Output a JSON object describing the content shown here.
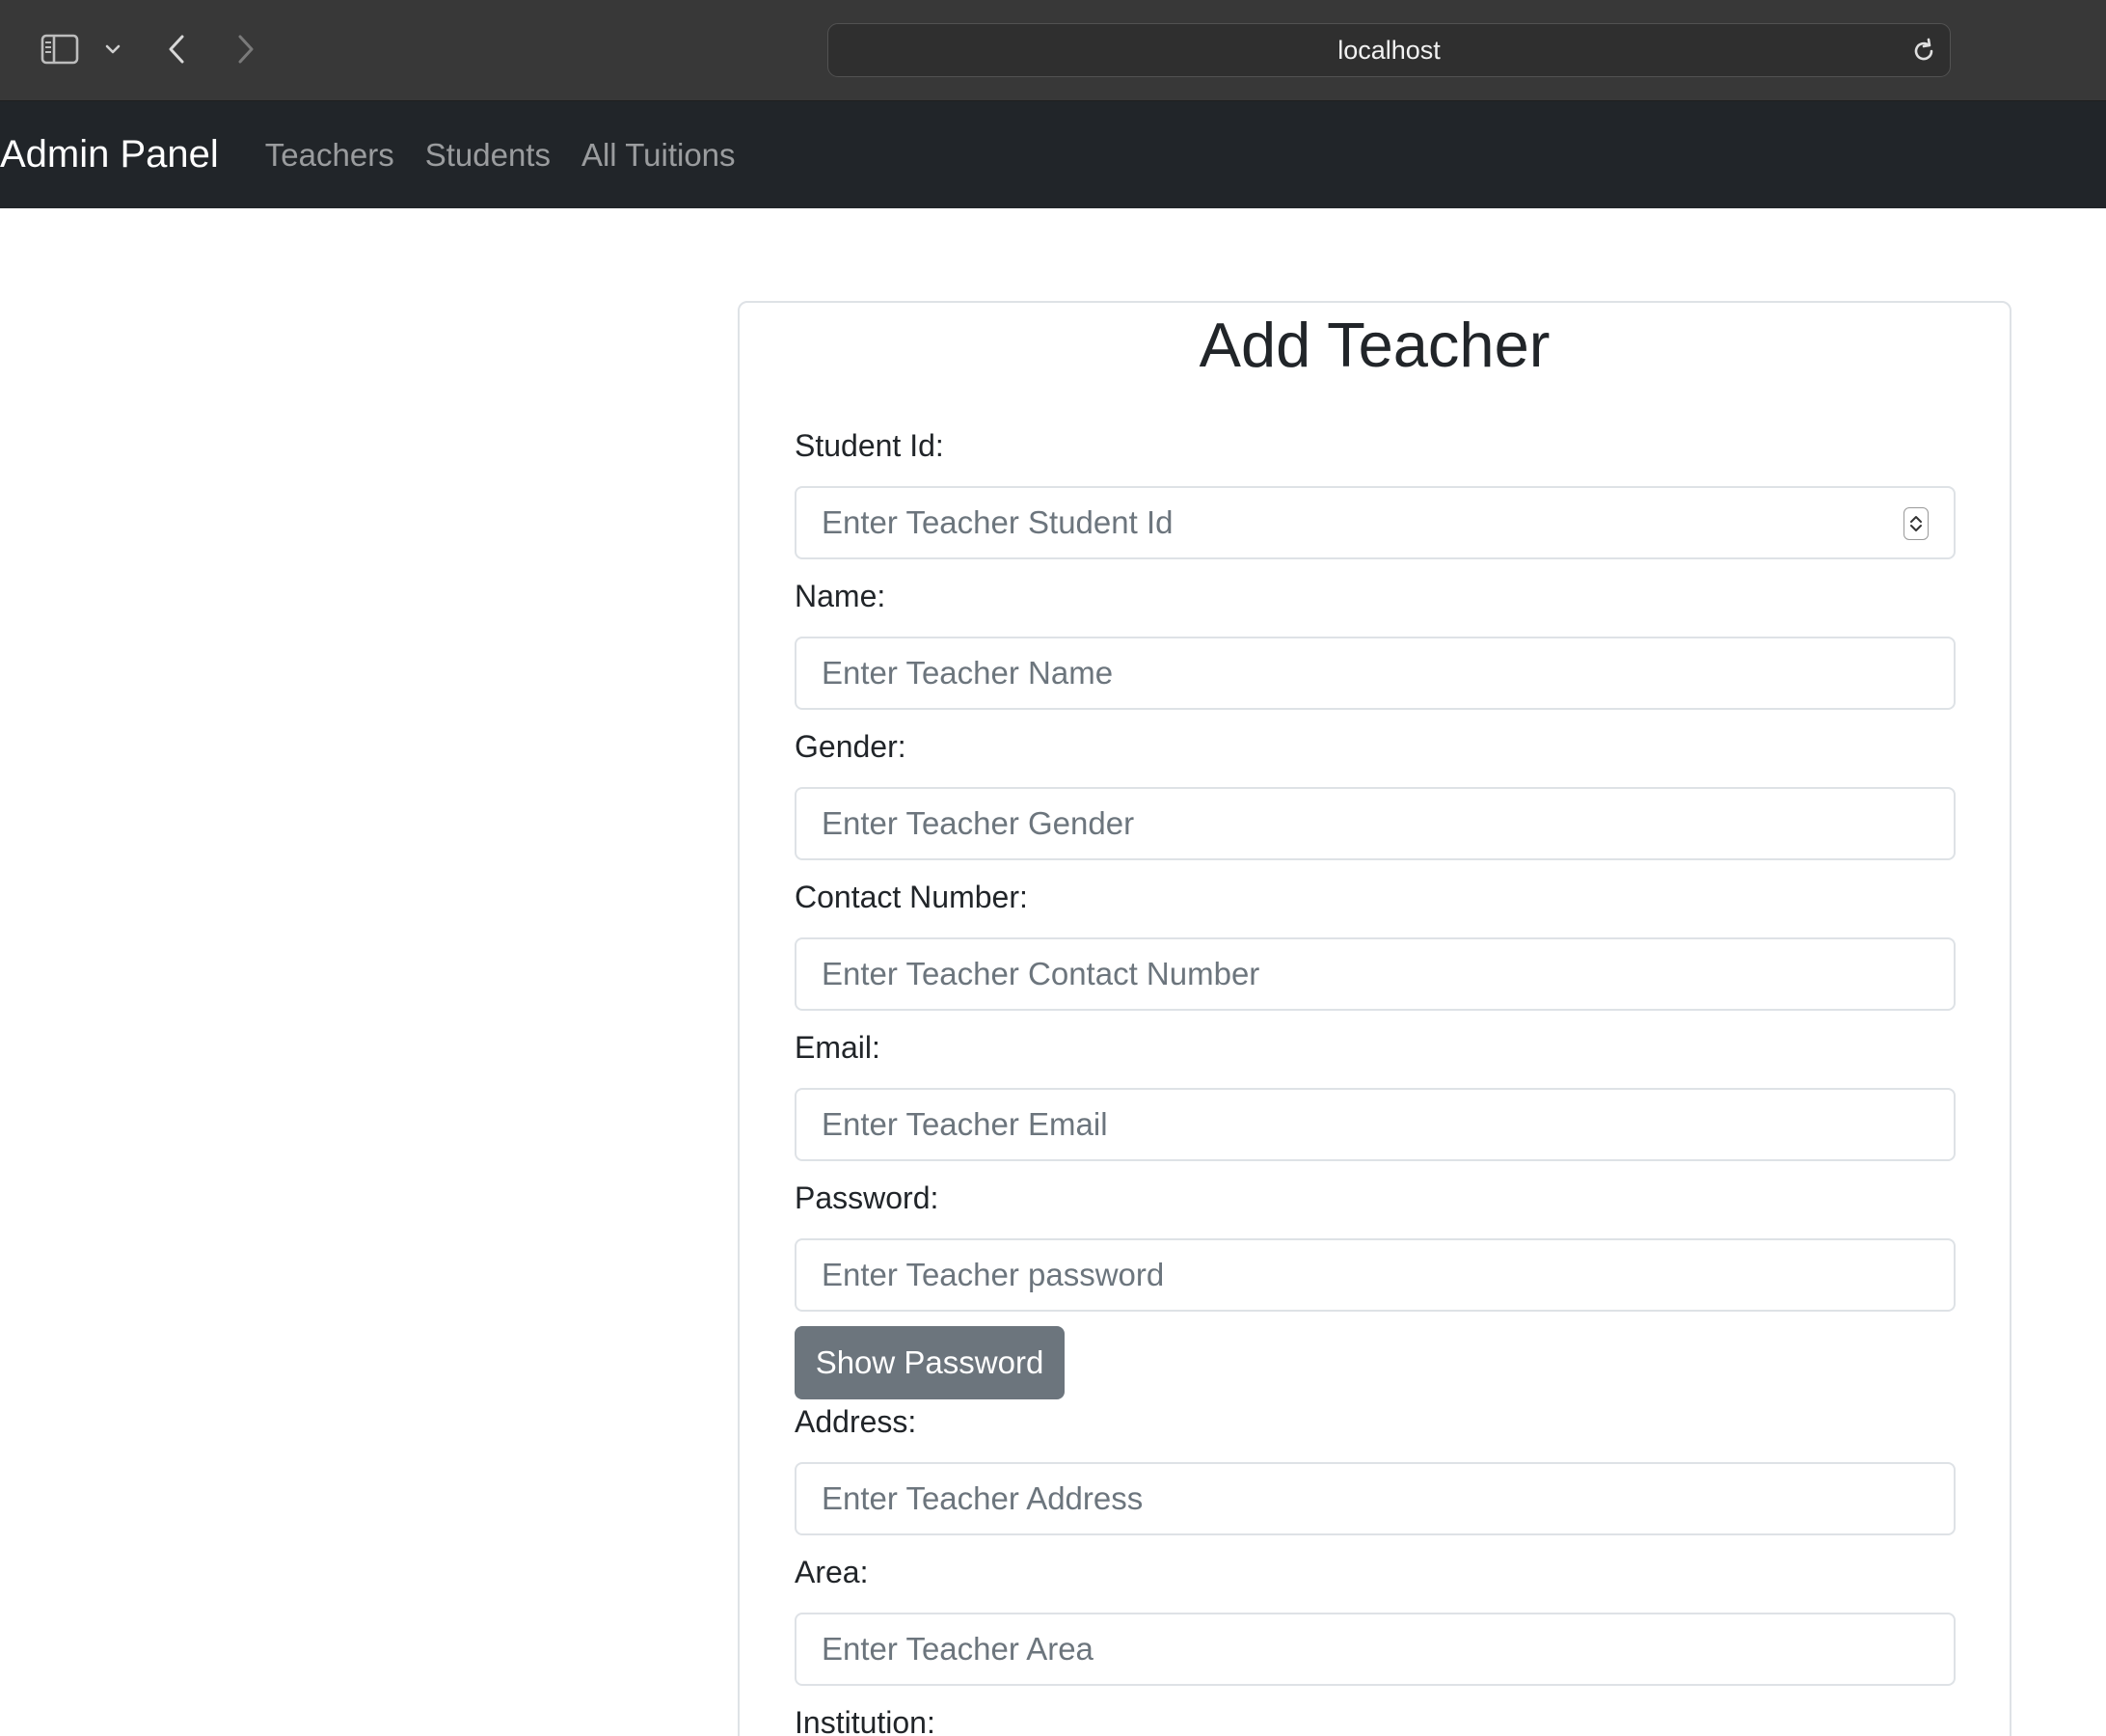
{
  "browser": {
    "url": "localhost"
  },
  "navbar": {
    "brand": "Admin Panel",
    "links": [
      "Teachers",
      "Students",
      "All Tuitions"
    ]
  },
  "form": {
    "title": "Add Teacher",
    "fields": [
      {
        "label": "Student Id:",
        "placeholder": "Enter Teacher Student Id",
        "type": "number"
      },
      {
        "label": "Name:",
        "placeholder": "Enter Teacher Name",
        "type": "text"
      },
      {
        "label": "Gender:",
        "placeholder": "Enter Teacher Gender",
        "type": "text"
      },
      {
        "label": "Contact Number:",
        "placeholder": "Enter Teacher Contact Number",
        "type": "text"
      },
      {
        "label": "Email:",
        "placeholder": "Enter Teacher Email",
        "type": "email"
      },
      {
        "label": "Password:",
        "placeholder": "Enter Teacher password",
        "type": "password"
      },
      {
        "label": "Address:",
        "placeholder": "Enter Teacher Address",
        "type": "text"
      },
      {
        "label": "Area:",
        "placeholder": "Enter Teacher Area",
        "type": "text"
      },
      {
        "label": "Institution:"
      }
    ],
    "show_password_label": "Show Password"
  }
}
